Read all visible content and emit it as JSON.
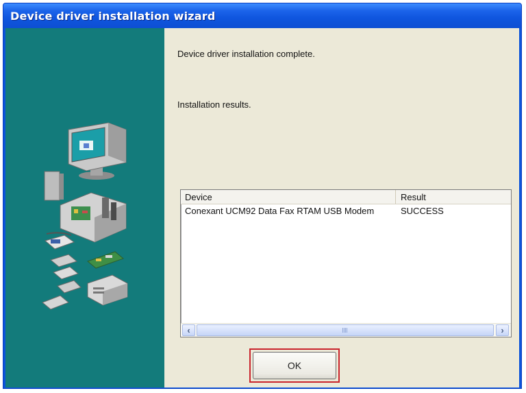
{
  "window": {
    "title": "Device driver installation wizard"
  },
  "messages": {
    "complete": "Device driver installation complete.",
    "results_label": "Installation results."
  },
  "results_table": {
    "columns": [
      "Device",
      "Result"
    ],
    "rows": [
      {
        "device": "Conexant UCM92 Data Fax RTAM USB Modem",
        "result": "SUCCESS"
      }
    ]
  },
  "scrollbar": {
    "left_icon": "chevron-left-icon",
    "right_icon": "chevron-right-icon"
  },
  "buttons": {
    "ok": "OK"
  },
  "colors": {
    "title_bar": "#0d4fd3",
    "side_panel": "#137b7b",
    "dialog_bg": "#ece9d8",
    "highlight": "#c9232b"
  }
}
